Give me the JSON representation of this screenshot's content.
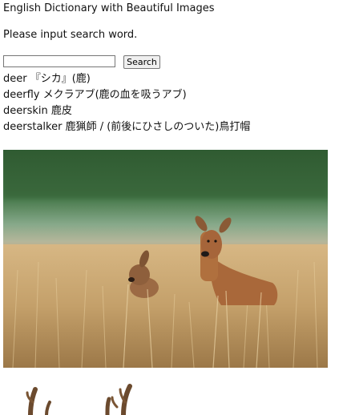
{
  "page": {
    "title": "English Dictionary with Beautiful Images",
    "prompt": "Please input search word."
  },
  "search": {
    "value": "",
    "placeholder": "",
    "button_label": "Search"
  },
  "results": [
    "deer 『シカ』(鹿)",
    "deerfly メクラアブ(鹿の血を吸うアブ)",
    "deerskin 鹿皮",
    "deerstalker 鹿猟師 / (前後にひさしのついた)鳥打帽"
  ],
  "images": {
    "main_photo": "roe-deer-doe-and-fawn-in-wheat-field",
    "second_photo": "deer-antlers-partial"
  },
  "colors": {
    "background": "#ffffff",
    "text": "#111111"
  }
}
